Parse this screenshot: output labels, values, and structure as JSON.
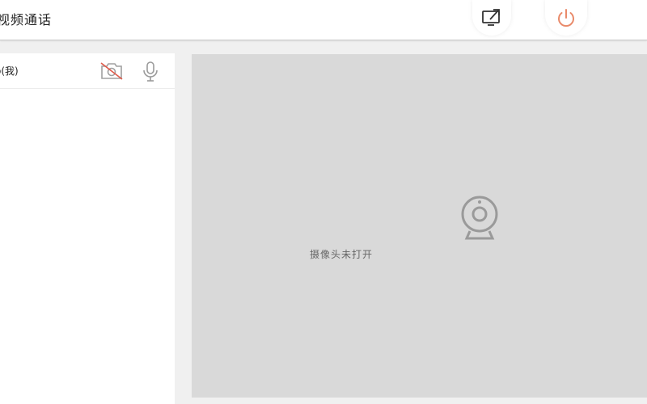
{
  "header": {
    "title": "视频通话",
    "share_icon": "share-screen-icon",
    "power_icon": "power-icon"
  },
  "participants": [
    {
      "name": "o(我)",
      "camera_icon": "camera-off-icon",
      "mic_icon": "microphone-icon"
    }
  ],
  "video": {
    "placeholder_icon": "camera-icon",
    "status_text": "摄像头未打开"
  },
  "colors": {
    "power_accent": "#e98a6a",
    "camera_off_slash": "#e05a4a",
    "video_background": "#d9d9d9",
    "icon_gray": "#9a9a9a"
  }
}
